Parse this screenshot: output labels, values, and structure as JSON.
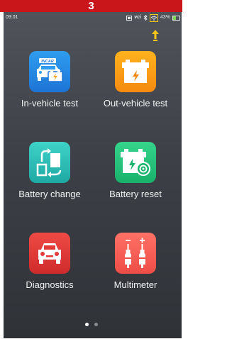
{
  "banner": {
    "label": "3"
  },
  "status_bar": {
    "time": "09:01",
    "vci": "vci",
    "battery": "43%"
  },
  "tiles": [
    {
      "label": "In-vehicle test",
      "icon": "incar-car-battery-icon",
      "badge": "INCAR",
      "color": "#2b8fe8"
    },
    {
      "label": "Out-vehicle test",
      "icon": "battery-charge-icon",
      "color": "#fb9c15"
    },
    {
      "label": "Battery change",
      "icon": "battery-swap-icon",
      "color": "#2ec0b7"
    },
    {
      "label": "Battery reset",
      "icon": "battery-reset-icon",
      "color": "#25c37c"
    },
    {
      "label": "Diagnostics",
      "icon": "car-front-icon",
      "color": "#e23b38"
    },
    {
      "label": "Multimeter",
      "icon": "multimeter-probes-icon",
      "color": "#f75f57"
    }
  ],
  "pager": {
    "pages": 2,
    "current": 1
  }
}
